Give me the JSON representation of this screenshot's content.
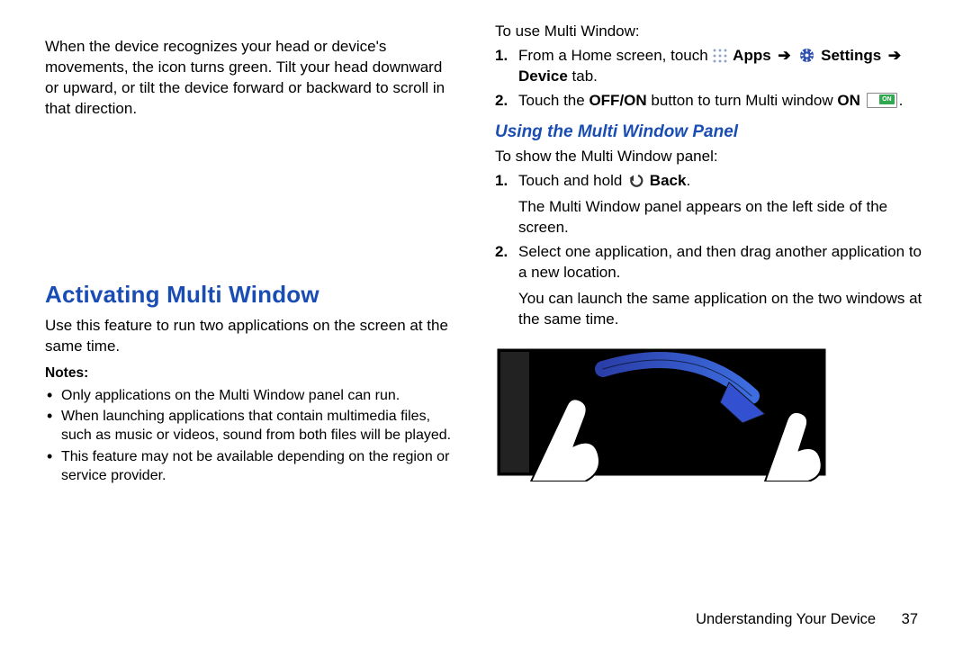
{
  "left": {
    "intro": "When the device recognizes your head or device's movements, the icon turns green. Tilt your head downward or upward, or tilt the device forward or backward to scroll in that direction.",
    "h2": "Activating Multi Window",
    "desc": "Use this feature to run two applications on the screen at the same time.",
    "notes_label": "Notes:",
    "notes": [
      "Only applications on the Multi Window panel can run.",
      "When launching applications that contain multimedia files, such as music or videos, sound from both files will be played.",
      "This feature may not be available depending on the region or service provider."
    ]
  },
  "right": {
    "use_intro": "To use Multi Window:",
    "step1_a": "From a Home screen, touch",
    "step1_apps": "Apps",
    "step1_arrow": "➔",
    "step1_settings": "Settings",
    "step1_arrow2": "➔",
    "step1_device_bold": "Device",
    "step1_device_rest": " tab.",
    "step2_a": "Touch the ",
    "step2_b": "OFF/ON",
    "step2_c": " button to turn Multi window ",
    "step2_on": "ON",
    "h3": "Using the Multi Window Panel",
    "panel_intro": "To show the Multi Window panel:",
    "panel1_a": "Touch and hold",
    "panel1_back": "Back",
    "panel1_b": ".",
    "panel1_sub": "The Multi Window panel appears on the left side of the screen.",
    "panel2": "Select one application, and then drag another application to a new location.",
    "panel2_sub": "You can launch the same application on the two windows at the same time."
  },
  "footer": {
    "section": "Understanding Your Device",
    "page": "37"
  }
}
